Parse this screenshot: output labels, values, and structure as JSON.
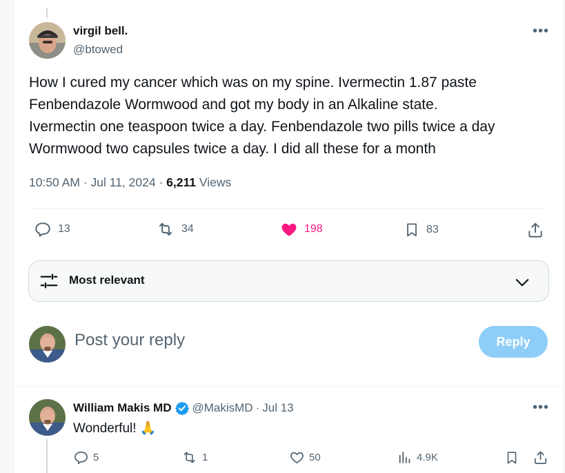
{
  "tweet": {
    "author_name": "virgil bell.",
    "author_handle": "@btowed",
    "more_label": "•••",
    "text": "How I cured my cancer which was on my spine. Ivermectin 1.87 paste\nFenbendazole  Wormwood  and got my body in an Alkaline state.\nIvermectin one teaspoon twice a day. Fenbendazole two pills twice a day\nWormwood two capsules twice a day. I did all these for a month",
    "time": "10:50 AM",
    "date": "Jul 11, 2024",
    "views_count": "6,211",
    "views_label": "Views",
    "stats": {
      "replies": "13",
      "reposts": "34",
      "likes": "198",
      "bookmarks": "83"
    }
  },
  "sort": {
    "label": "Most relevant"
  },
  "composer": {
    "placeholder": "Post your reply",
    "button_label": "Reply"
  },
  "reply": {
    "author_name": "William Makis MD",
    "author_handle": "@MakisMD",
    "date": "Jul 13",
    "text": "Wonderful!",
    "emoji": "🙏",
    "more_label": "•••",
    "stats": {
      "replies": "5",
      "reposts": "1",
      "likes": "50",
      "views": "4.9K"
    }
  },
  "colors": {
    "like_active": "#f91880",
    "verified": "#1d9bf0",
    "reply_button": "#8ecdf8",
    "secondary_text": "#536471"
  },
  "icons": [
    "reply-icon",
    "repost-icon",
    "heart-icon",
    "bookmark-icon",
    "share-icon",
    "filter-icon",
    "chevron-down-icon",
    "verified-badge-icon",
    "views-icon"
  ]
}
